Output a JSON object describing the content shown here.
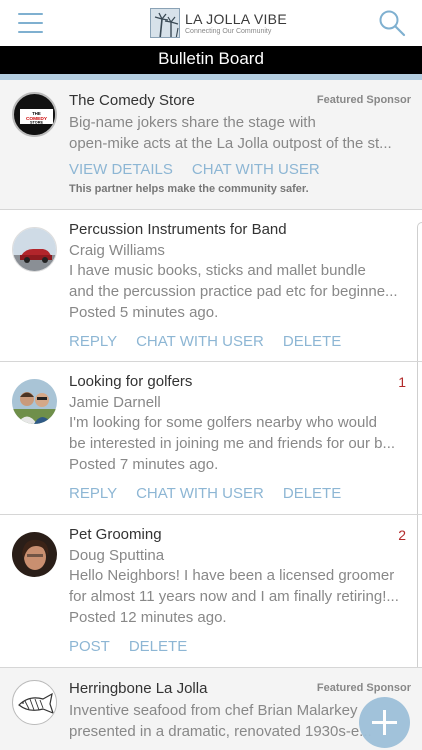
{
  "header": {
    "app_name": "LA JOLLA VIBE",
    "tagline": "Connecting Our Community",
    "page_title": "Bulletin Board"
  },
  "posts": [
    {
      "title": "The Comedy Store",
      "badge": "Featured Sponsor",
      "avatar_text": "THE COMEDY STORE",
      "lines": [
        "Big-name jokers share the stage with",
        "open-mike acts at the La Jolla outpost of the st..."
      ],
      "actions": [
        "VIEW DETAILS",
        "CHAT WITH USER"
      ],
      "note": "This partner helps make the community safer."
    },
    {
      "title": "Percussion Instruments for Band",
      "author": "Craig Williams",
      "lines": [
        "I have music books, sticks and mallet bundle",
        "and the percussion practice pad etc for beginne..."
      ],
      "posted": "Posted 5 minutes ago.",
      "actions": [
        "REPLY",
        "CHAT WITH USER",
        "DELETE"
      ]
    },
    {
      "title": "Looking for golfers",
      "count": "1",
      "author": "Jamie Darnell",
      "lines": [
        "I'm looking for some golfers nearby who would",
        "be interested in joining me and friends for our b..."
      ],
      "posted": "Posted 7 minutes ago.",
      "actions": [
        "REPLY",
        "CHAT WITH USER",
        "DELETE"
      ]
    },
    {
      "title": "Pet Grooming",
      "count": "2",
      "author": "Doug Sputtina",
      "lines": [
        "Hello Neighbors! I have been a licensed groomer",
        "for almost 11 years now and I am finally retiring!..."
      ],
      "posted": "Posted 12 minutes ago.",
      "actions": [
        "POST",
        "DELETE"
      ]
    },
    {
      "title": "Herringbone La Jolla",
      "badge": "Featured Sponsor",
      "lines": [
        "Inventive seafood from chef Brian Malarkey",
        "presented in a dramatic, renovated 1930s-e..."
      ]
    }
  ],
  "colors": {
    "accent": "#8db6d4",
    "count": "#b22a2a",
    "bar": "#000000"
  }
}
